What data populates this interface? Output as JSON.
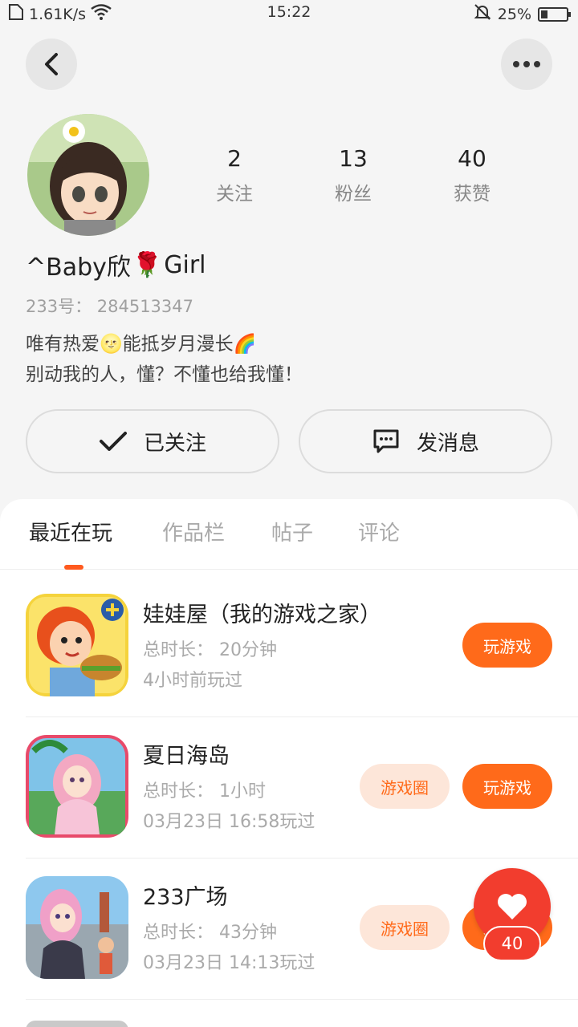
{
  "status_bar": {
    "net_speed": "1.61K/s",
    "time": "15:22",
    "battery": "25%",
    "battery_level": 0.25
  },
  "profile": {
    "nickname_left": "^Baby欣",
    "nickname_emoji": "🌹",
    "nickname_right": "Girl",
    "user_id": "233号： 284513347",
    "bio_line1_a": "唯有热爱",
    "bio_line1_emoji1": "🌝",
    "bio_line1_b": "能抵岁月漫长",
    "bio_line1_emoji2": "🌈",
    "bio_line2": "别动我的人，懂？不懂也给我懂！"
  },
  "stats": [
    {
      "num": "2",
      "label": "关注"
    },
    {
      "num": "13",
      "label": "粉丝"
    },
    {
      "num": "40",
      "label": "获赞"
    }
  ],
  "actions": {
    "follow_label": "已关注",
    "message_label": "发消息"
  },
  "tabs": [
    "最近在玩",
    "作品栏",
    "帖子",
    "评论"
  ],
  "games": [
    {
      "name": "娃娃屋（我的游戏之家）",
      "time": "总时长： 20分钟",
      "last": "4小时前玩过",
      "play": "玩游戏",
      "circle": ""
    },
    {
      "name": "夏日海岛",
      "time": "总时长： 1小时",
      "last": "03月23日 16:58玩过",
      "play": "玩游戏",
      "circle": "游戏圈"
    },
    {
      "name": "233广场",
      "time": "总时长： 43分钟",
      "last": "03月23日 14:13玩过",
      "play": "玩游戏",
      "circle": "游戏圈"
    }
  ],
  "like": {
    "count": "40"
  },
  "colors": {
    "accent": "#ff6a1a",
    "like": "#f23d2e",
    "tab_indicator": "#ff5a1f"
  }
}
